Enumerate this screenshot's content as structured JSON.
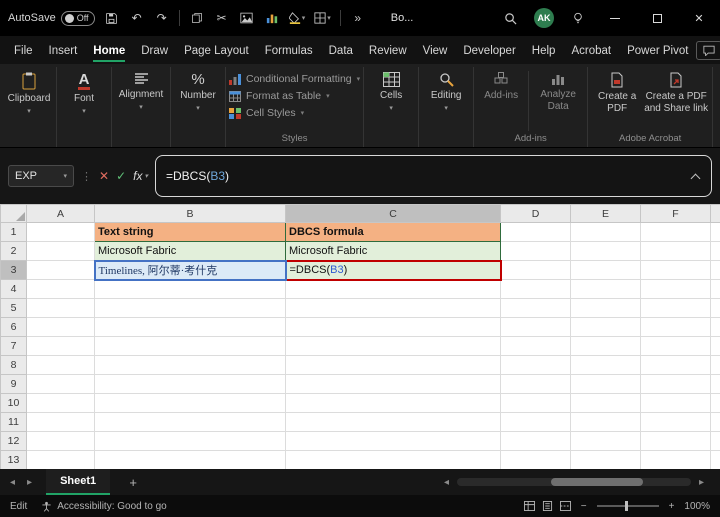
{
  "title_bar": {
    "autosave_label": "AutoSave",
    "autosave_state": "Off",
    "workbook_name": "Bo...",
    "avatar_initials": "AK"
  },
  "menu": {
    "items": [
      "File",
      "Insert",
      "Home",
      "Draw",
      "Page Layout",
      "Formulas",
      "Data",
      "Review",
      "View",
      "Developer",
      "Help",
      "Acrobat",
      "Power Pivot"
    ],
    "active": "Home"
  },
  "ribbon": {
    "clipboard": "Clipboard",
    "font": "Font",
    "alignment": "Alignment",
    "number": "Number",
    "conditional_formatting": "Conditional Formatting",
    "format_as_table": "Format as Table",
    "cell_styles": "Cell Styles",
    "styles_group": "Styles",
    "cells": "Cells",
    "editing": "Editing",
    "add_ins": "Add-ins",
    "analyze_data": "Analyze Data",
    "add_ins_group": "Add-ins",
    "create_pdf": "Create a PDF",
    "create_pdf_share": "Create a PDF and Share link",
    "acrobat_group": "Adobe Acrobat"
  },
  "formula_bar": {
    "name_box": "EXP",
    "fx": "fx",
    "formula_pre": "=DBCS(",
    "formula_ref": "B3",
    "formula_post": ")"
  },
  "grid": {
    "columns": [
      "A",
      "B",
      "C",
      "D",
      "E",
      "F"
    ],
    "rows": [
      "1",
      "2",
      "3",
      "4",
      "5",
      "6",
      "7",
      "8",
      "9",
      "10",
      "11",
      "12",
      "13"
    ],
    "b1": "Text string",
    "c1": "DBCS formula",
    "b2": "Microsoft Fabric",
    "c2": "Microsoft Fabric",
    "b3": "Timelines, 阿尔蒂·考什克",
    "c3_pre": "=DBCS(",
    "c3_ref": "B3",
    "c3_post": ")"
  },
  "sheet_tabs": {
    "tabs": [
      "Sheet1"
    ],
    "active": "Sheet1"
  },
  "status_bar": {
    "mode": "Edit",
    "accessibility": "Accessibility: Good to go",
    "zoom": "100%"
  },
  "icons": {
    "chevron_down": "▾",
    "overflow": "»",
    "cut": "✂",
    "undo": "↶",
    "redo": "↷",
    "close": "✕",
    "cancel": "✕",
    "check": "✓",
    "dots": "⋮",
    "scroll_left": "◂",
    "scroll_right": "▸",
    "plus": "+",
    "minus": "−",
    "font_a": "A",
    "percent": "%"
  },
  "colors": {
    "accent_green": "#21A366",
    "header_fill": "#F4B183",
    "green_fill": "#E2EFDA",
    "blue_fill": "#DCEAF7",
    "ref_blue": "#4472C4",
    "annotation_red": "#C00000"
  }
}
